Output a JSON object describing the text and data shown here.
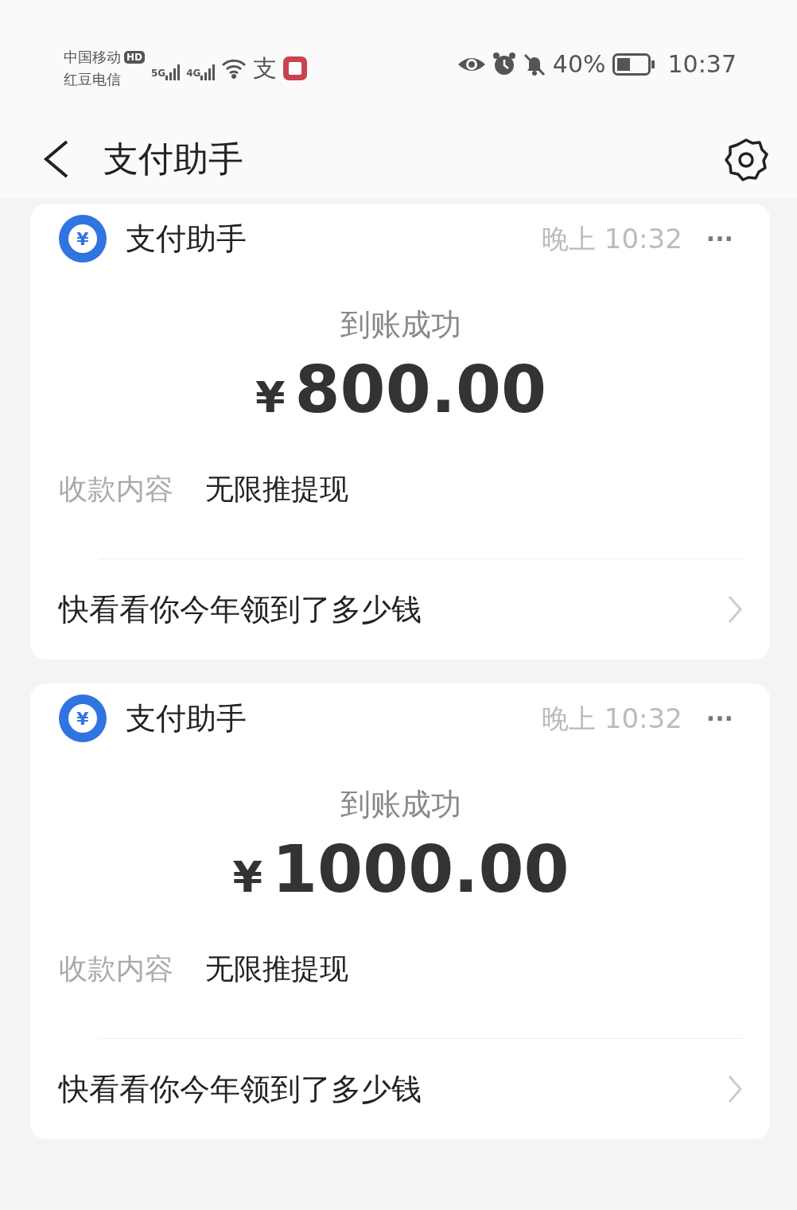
{
  "status_bar": {
    "carriers": [
      "中国移动",
      "红豆电信"
    ],
    "hd_badge": "HD",
    "networks": [
      "5G",
      "4G"
    ],
    "app_glyph": "支",
    "battery_percent": "40%",
    "time": "10:37"
  },
  "header": {
    "title": "支付助手"
  },
  "messages": [
    {
      "sender": "支付助手",
      "avatar_glyph": "¥",
      "time": "晚上 10:32",
      "more": "···",
      "status": "到账成功",
      "currency": "¥",
      "amount": "800.00",
      "detail_label": "收款内容",
      "detail_value": "无限推提现",
      "link": "快看看你今年领到了多少钱"
    },
    {
      "sender": "支付助手",
      "avatar_glyph": "¥",
      "time": "晚上 10:32",
      "more": "···",
      "status": "到账成功",
      "currency": "¥",
      "amount": "1000.00",
      "detail_label": "收款内容",
      "detail_value": "无限推提现",
      "link": "快看看你今年领到了多少钱"
    }
  ]
}
